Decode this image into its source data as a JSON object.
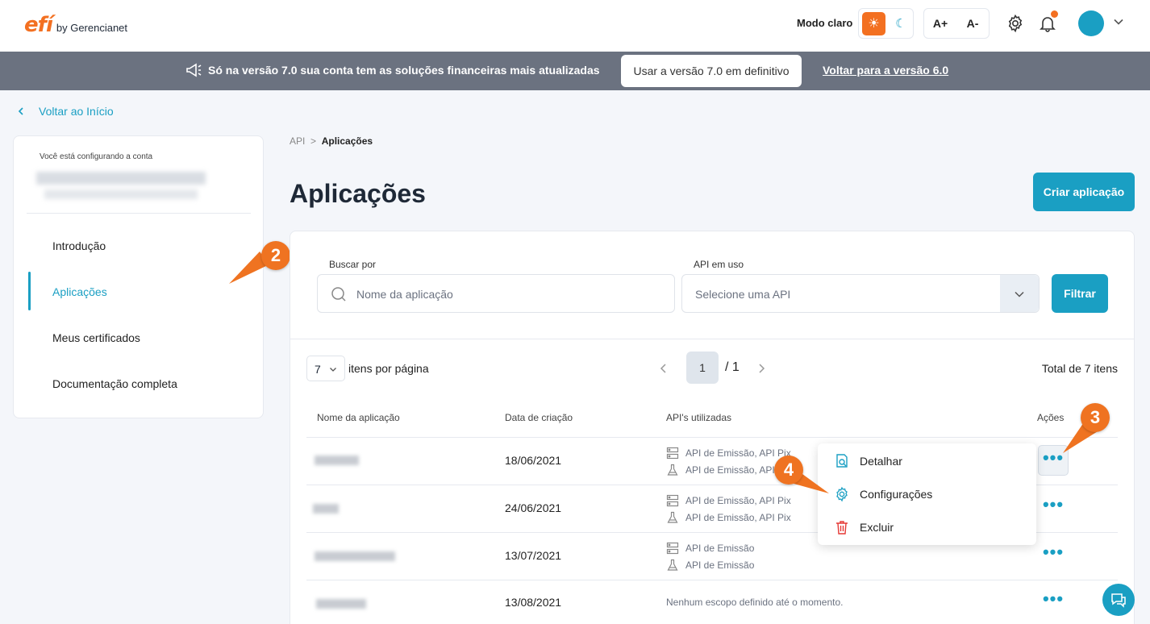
{
  "header": {
    "logo_mark": "efí",
    "logo_by": "by Gerencianet",
    "mode_label": "Modo claro",
    "font_increase": "A+",
    "font_decrease": "A-"
  },
  "banner": {
    "text": "Só na versão 7.0 sua conta tem as soluções financeiras mais atualizadas",
    "button": "Usar a versão 7.0 em definitivo",
    "link": "Voltar para a versão 6.0"
  },
  "back_link": "Voltar ao Início",
  "sidebar": {
    "caption": "Você está configurando a conta",
    "items": [
      {
        "label": "Introdução"
      },
      {
        "label": "Aplicações"
      },
      {
        "label": "Meus certificados"
      },
      {
        "label": "Documentação completa"
      }
    ]
  },
  "markers": [
    "2",
    "3",
    "4"
  ],
  "breadcrumb": {
    "root": "API",
    "sep": ">",
    "current": "Aplicações"
  },
  "page_title": "Aplicações",
  "create_button": "Criar aplicação",
  "filters": {
    "search_label": "Buscar por",
    "search_placeholder": "Nome da aplicação",
    "api_label": "API em uso",
    "api_placeholder": "Selecione uma API",
    "filter_button": "Filtrar"
  },
  "pagination": {
    "per_page": "7",
    "per_page_label": "itens por página",
    "current_page": "1",
    "total_pages": "/ 1",
    "total_items": "Total de 7 itens"
  },
  "table": {
    "headers": [
      "Nome da aplicação",
      "Data de criação",
      "API's utilizadas",
      "Ações"
    ],
    "rows": [
      {
        "date": "18/06/2021",
        "api_prod": "API de Emissão, API Pix",
        "api_homolog": "API de Emissão, API Pix"
      },
      {
        "date": "24/06/2021",
        "api_prod": "API de Emissão, API Pix",
        "api_homolog": "API de Emissão, API Pix"
      },
      {
        "date": "13/07/2021",
        "api_prod": "API de Emissão",
        "api_homolog": "API de Emissão"
      },
      {
        "date": "13/08/2021",
        "api_empty": "Nenhum escopo definido até o momento."
      }
    ],
    "actions_label": "•••"
  },
  "dropdown": {
    "items": [
      {
        "label": "Detalhar"
      },
      {
        "label": "Configurações"
      },
      {
        "label": "Excluir"
      }
    ]
  }
}
